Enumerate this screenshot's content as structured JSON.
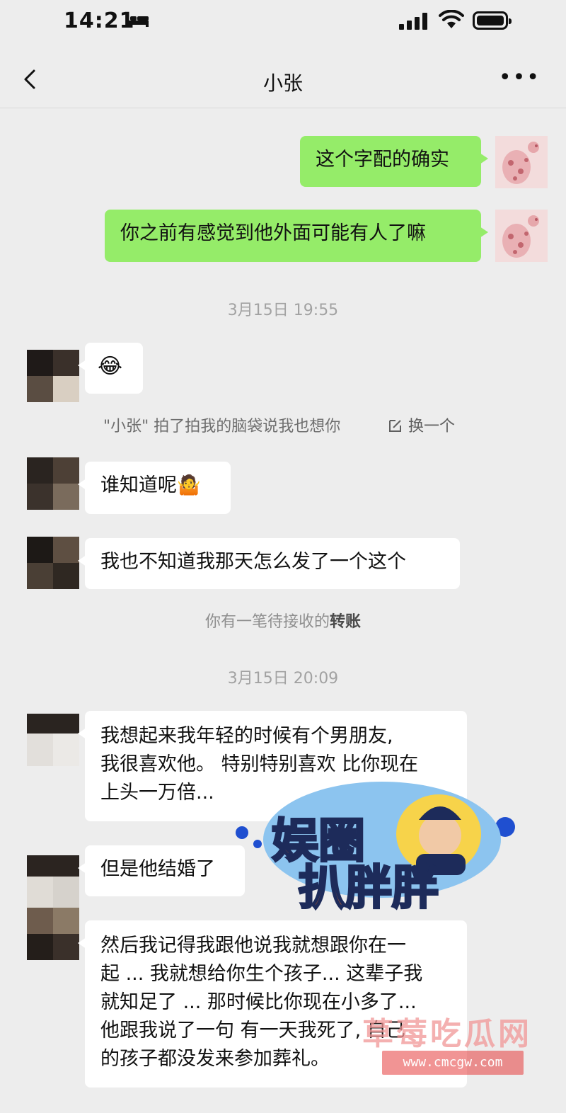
{
  "status_bar": {
    "time": "14:21",
    "icons": [
      "sleep-mode-icon",
      "cellular-signal-icon",
      "wifi-icon",
      "battery-icon"
    ]
  },
  "nav": {
    "title": "小张",
    "back_icon": "chevron-left-icon",
    "more_icon": "more-icon",
    "more_text": "•••"
  },
  "messages": {
    "m1": "这个字配的确实",
    "m2": "你之前有感觉到他外面可能有人了嘛",
    "ts1": "3月15日 19:55",
    "emoji1": "😂",
    "pat": "\"小张\" 拍了拍我的脑袋说我也想你",
    "pat_action": "换一个",
    "m4": "谁知道呢",
    "m4_emoji": "🤷",
    "m5": "我也不知道我那天怎么发了一个这个",
    "transfer_prefix": "你有一笔待接收的",
    "transfer_link": "转账",
    "ts2": "3月15日 20:09",
    "m6_l1": "我想起来我年轻的时候有个男朋友,",
    "m6_l2": "我很喜欢他。 特别特别喜欢 比你现在",
    "m6_l3": "上头一万倍...",
    "m7": "但是他结婚了",
    "m8_l1": "然后我记得我跟他说我就想跟你在一",
    "m8_l2": "起 ... 我就想给你生个孩子... 这辈子我",
    "m8_l3": "就知足了 ... 那时候比你现在小多了...",
    "m8_l4": "他跟我说了一句 有一天我死了, 自己",
    "m8_l5": "的孩子都没发来参加葬礼。"
  },
  "watermark": {
    "logo_line1": "娱圈",
    "logo_line2": "扒胖胖",
    "site_name": "草莓吃瓜网",
    "site_url": "www.cmcgw.com"
  },
  "colors": {
    "background": "#ededed",
    "my_bubble": "#95ec69",
    "other_bubble": "#ffffff"
  }
}
